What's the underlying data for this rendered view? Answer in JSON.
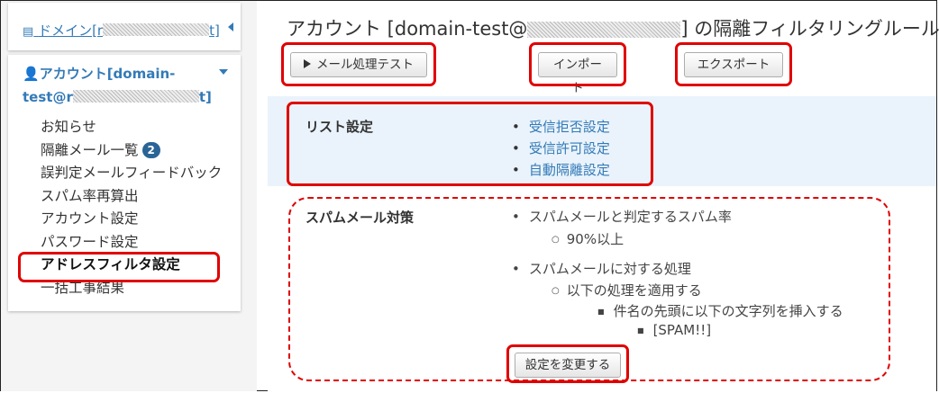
{
  "sidebar": {
    "domain_link": "ドメイン[r",
    "domain_link_end": "t]",
    "account_title_line1": "アカウント[domain-",
    "account_title_line2_start": "test@r",
    "account_title_line2_end": "t]",
    "nav": [
      {
        "label": "お知らせ"
      },
      {
        "label": "隔離メール一覧",
        "badge": "2"
      },
      {
        "label": "誤判定メールフィードバック"
      },
      {
        "label": "スパム率再算出"
      },
      {
        "label": "アカウント設定"
      },
      {
        "label": "パスワード設定"
      },
      {
        "label": "アドレスフィルタ設定"
      },
      {
        "label": "一括工事結果"
      }
    ]
  },
  "main": {
    "title_start": "アカウント [domain-test@",
    "title_end": "] の隔離フィルタリングルール",
    "buttons": {
      "mail_test": "メール処理テスト",
      "import": "インポート",
      "export": "エクスポート",
      "change": "設定を変更する"
    },
    "list_settings": {
      "label": "リスト設定",
      "links": [
        "受信拒否設定",
        "受信許可設定",
        "自動隔離設定"
      ]
    },
    "spam": {
      "label": "スパムメール対策",
      "rate_heading": "スパムメールと判定するスパム率",
      "rate_value": "90%以上",
      "process_heading": "スパムメールに対する処理",
      "process_apply": "以下の処理を適用する",
      "process_detail": "件名の先頭に以下の文字列を挿入する",
      "prefix": "[SPAM!!]"
    }
  },
  "colors": {
    "link": "#337ab7",
    "highlight": "#e00000",
    "list_row_bg": "#eaf3fb"
  }
}
